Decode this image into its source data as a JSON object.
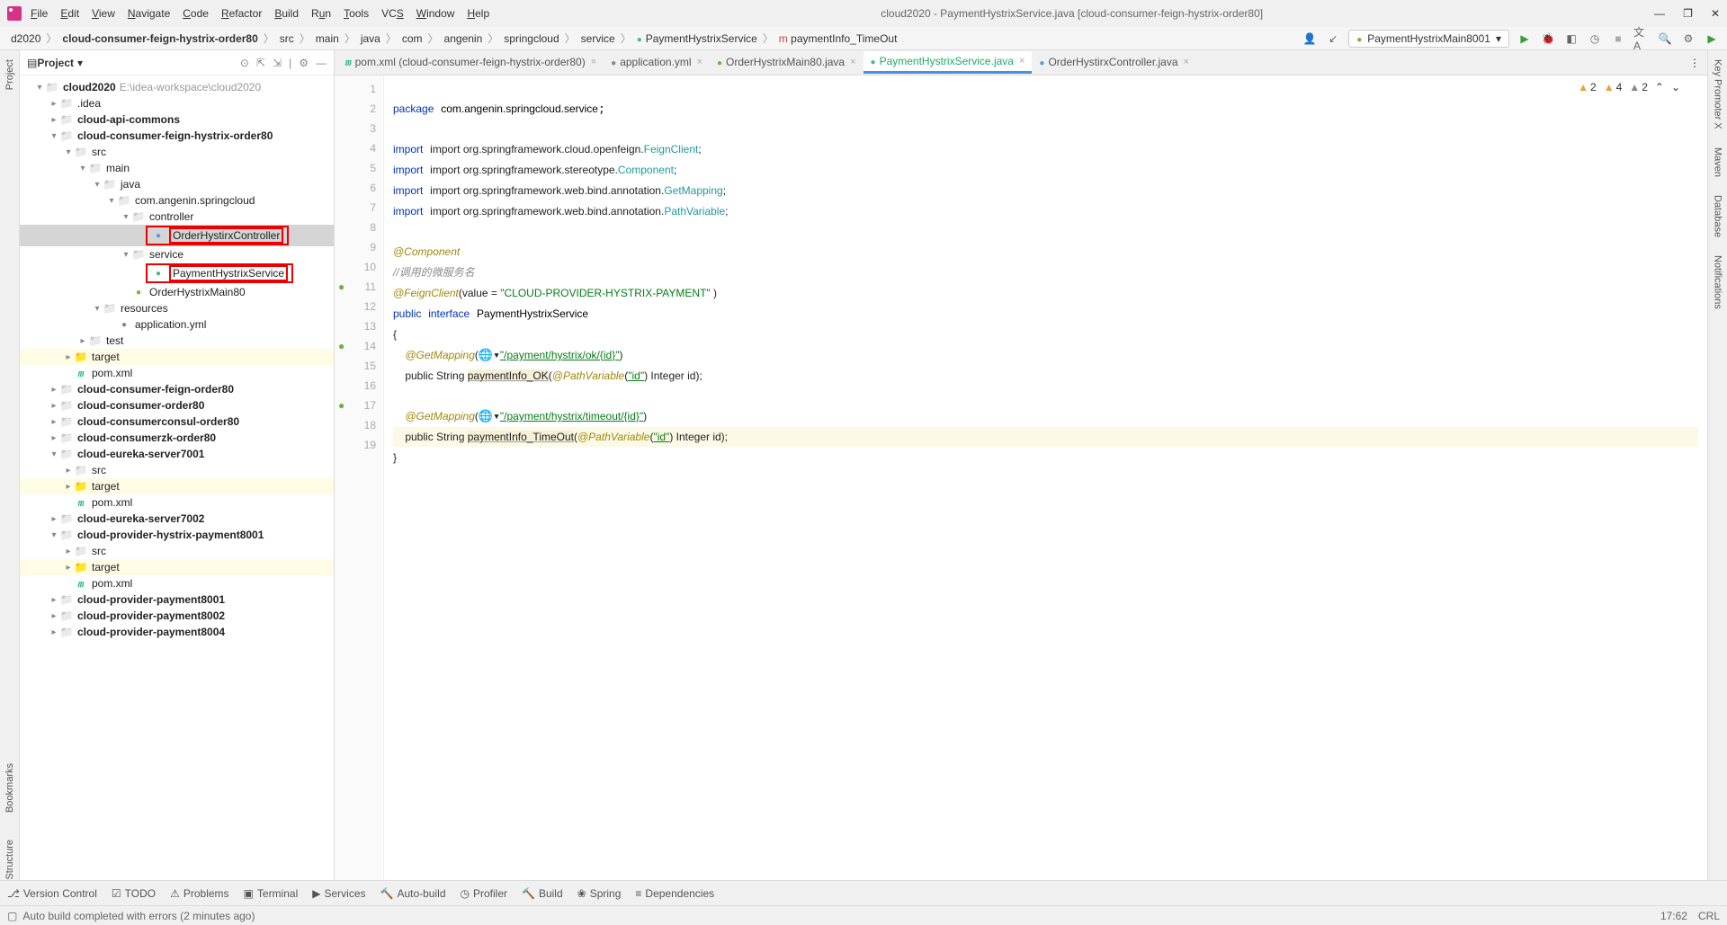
{
  "title": "cloud2020 - PaymentHystrixService.java [cloud-consumer-feign-hystrix-order80]",
  "menu": [
    "File",
    "Edit",
    "View",
    "Navigate",
    "Code",
    "Refactor",
    "Build",
    "Run",
    "Tools",
    "VCS",
    "Window",
    "Help"
  ],
  "breadcrumbs": [
    "d2020",
    "cloud-consumer-feign-hystrix-order80",
    "src",
    "main",
    "java",
    "com",
    "angenin",
    "springcloud",
    "service",
    "PaymentHystrixService",
    "paymentInfo_TimeOut"
  ],
  "run_config": "PaymentHystrixMain8001",
  "panel": {
    "title": "Project"
  },
  "project_root": {
    "name": "cloud2020",
    "path": "E:\\idea-workspace\\cloud2020"
  },
  "tree": [
    {
      "d": 1,
      "a": "▾",
      "i": "folder-ico",
      "n": "cloud2020",
      "bold": true,
      "extra": "E:\\idea-workspace\\cloud2020"
    },
    {
      "d": 2,
      "a": "▸",
      "i": "folder-ico",
      "n": ".idea"
    },
    {
      "d": 2,
      "a": "▸",
      "i": "folder-ico",
      "n": "cloud-api-commons",
      "bold": true
    },
    {
      "d": 2,
      "a": "▾",
      "i": "folder-ico",
      "n": "cloud-consumer-feign-hystrix-order80",
      "bold": true
    },
    {
      "d": 3,
      "a": "▾",
      "i": "folder-ico",
      "n": "src"
    },
    {
      "d": 4,
      "a": "▾",
      "i": "folder-ico",
      "n": "main"
    },
    {
      "d": 5,
      "a": "▾",
      "i": "folder-ico",
      "n": "java"
    },
    {
      "d": 6,
      "a": "▾",
      "i": "folder-ico",
      "n": "com.angenin.springcloud"
    },
    {
      "d": 7,
      "a": "▾",
      "i": "folder-ico",
      "n": "controller"
    },
    {
      "d": 8,
      "a": "",
      "i": "class-ico",
      "n": "OrderHystirxController",
      "box": true,
      "sel": true
    },
    {
      "d": 7,
      "a": "▾",
      "i": "folder-ico",
      "n": "service"
    },
    {
      "d": 8,
      "a": "",
      "i": "java-ico",
      "n": "PaymentHystrixService",
      "box": true
    },
    {
      "d": 7,
      "a": "",
      "i": "spring-ico",
      "n": "OrderHystrixMain80"
    },
    {
      "d": 5,
      "a": "▾",
      "i": "folder-ico",
      "n": "resources"
    },
    {
      "d": 6,
      "a": "",
      "i": "yml-ico",
      "n": "application.yml"
    },
    {
      "d": 4,
      "a": "▸",
      "i": "folder-ico",
      "n": "test"
    },
    {
      "d": 3,
      "a": "▸",
      "i": "folder-target",
      "n": "target",
      "hl": true
    },
    {
      "d": 3,
      "a": "",
      "i": "xml-ico",
      "n": "pom.xml"
    },
    {
      "d": 2,
      "a": "▸",
      "i": "folder-ico",
      "n": "cloud-consumer-feign-order80",
      "bold": true
    },
    {
      "d": 2,
      "a": "▸",
      "i": "folder-ico",
      "n": "cloud-consumer-order80",
      "bold": true
    },
    {
      "d": 2,
      "a": "▸",
      "i": "folder-ico",
      "n": "cloud-consumerconsul-order80",
      "bold": true
    },
    {
      "d": 2,
      "a": "▸",
      "i": "folder-ico",
      "n": "cloud-consumerzk-order80",
      "bold": true
    },
    {
      "d": 2,
      "a": "▾",
      "i": "folder-ico",
      "n": "cloud-eureka-server7001",
      "bold": true
    },
    {
      "d": 3,
      "a": "▸",
      "i": "folder-ico",
      "n": "src"
    },
    {
      "d": 3,
      "a": "▸",
      "i": "folder-target",
      "n": "target",
      "hl": true
    },
    {
      "d": 3,
      "a": "",
      "i": "xml-ico",
      "n": "pom.xml"
    },
    {
      "d": 2,
      "a": "▸",
      "i": "folder-ico",
      "n": "cloud-eureka-server7002",
      "bold": true
    },
    {
      "d": 2,
      "a": "▾",
      "i": "folder-ico",
      "n": "cloud-provider-hystrix-payment8001",
      "bold": true
    },
    {
      "d": 3,
      "a": "▸",
      "i": "folder-ico",
      "n": "src"
    },
    {
      "d": 3,
      "a": "▸",
      "i": "folder-target",
      "n": "target",
      "hl": true
    },
    {
      "d": 3,
      "a": "",
      "i": "xml-ico",
      "n": "pom.xml"
    },
    {
      "d": 2,
      "a": "▸",
      "i": "folder-ico",
      "n": "cloud-provider-payment8001",
      "bold": true
    },
    {
      "d": 2,
      "a": "▸",
      "i": "folder-ico",
      "n": "cloud-provider-payment8002",
      "bold": true
    },
    {
      "d": 2,
      "a": "▸",
      "i": "folder-ico",
      "n": "cloud-provider-payment8004",
      "bold": true
    }
  ],
  "tabs": [
    {
      "ico": "xml-ico",
      "label": "pom.xml (cloud-consumer-feign-hystrix-order80)",
      "close": true
    },
    {
      "ico": "yml-ico",
      "label": "application.yml",
      "close": true
    },
    {
      "ico": "spring-ico",
      "label": "OrderHystrixMain80.java",
      "close": true
    },
    {
      "ico": "java-ico",
      "label": "PaymentHystrixService.java",
      "active": true,
      "close": true
    },
    {
      "ico": "class-ico",
      "label": "OrderHystirxController.java",
      "close": true
    }
  ],
  "gutter_lines": [
    "1",
    "2",
    "3",
    "4",
    "5",
    "6",
    "7",
    "8",
    "9",
    "10",
    "11",
    "12",
    "13",
    "14",
    "15",
    "16",
    "17",
    "18",
    "19"
  ],
  "code": {
    "l1": "package com.angenin.springcloud.service;",
    "l3": "import org.springframework.cloud.openfeign.",
    "l3b": "FeignClient",
    "l3c": ";",
    "l4": "import org.springframework.stereotype.",
    "l4b": "Component",
    "l4c": ";",
    "l5": "import org.springframework.web.bind.annotation.",
    "l5b": "GetMapping",
    "l5c": ";",
    "l6": "import org.springframework.web.bind.annotation.",
    "l6b": "PathVariable",
    "l6c": ";",
    "l8": "@Component",
    "l9": "//调用的微服务名",
    "l10": "@FeignClient",
    "l10b": "(value = ",
    "l10c": "\"CLOUD-PROVIDER-HYSTRIX-PAYMENT\"",
    "l10d": " )",
    "l11": "public interface PaymentHystrixService",
    "l12": "{",
    "l13a": "    @GetMapping",
    "l13b": "(",
    "l13c": "\"/payment/hystrix/ok/{id}\"",
    "l13d": ")",
    "l14a": "    public String ",
    "l14b": "paymentInfo_OK",
    "l14c": "(",
    "l14d": "@PathVariable",
    "l14e": "(",
    "l14f": "\"id\"",
    "l14g": ") Integer id);",
    "l16a": "    @GetMapping",
    "l16b": "(",
    "l16c": "\"/payment/hystrix/timeout/{id}\"",
    "l16d": ")",
    "l17a": "    public String ",
    "l17b": "paymentInfo_TimeOut",
    "l17c": "(",
    "l17d": "@PathVariable",
    "l17e": "(",
    "l17f": "\"id\"",
    "l17g": ") Integer id);",
    "l18": "}"
  },
  "warnings": {
    "a": "2",
    "b": "4",
    "c": "2"
  },
  "bottom": [
    "Version Control",
    "TODO",
    "Problems",
    "Terminal",
    "Services",
    "Auto-build",
    "Profiler",
    "Build",
    "Spring",
    "Dependencies"
  ],
  "status": {
    "msg": "Auto build completed with errors (2 minutes ago)",
    "time": "17:62",
    "enc": "CRL"
  },
  "side_right": [
    "Key Promoter X",
    "Maven",
    "Database",
    "Notifications"
  ],
  "side_left": [
    "Project",
    "Bookmarks",
    "Structure"
  ]
}
